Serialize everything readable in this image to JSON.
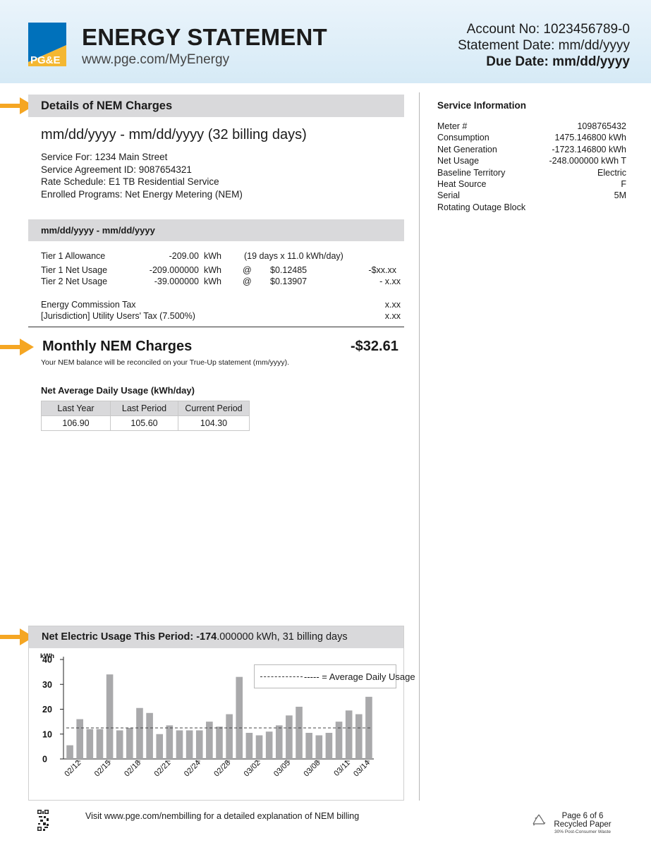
{
  "header": {
    "logo_text": "PG&E",
    "title": "ENERGY STATEMENT",
    "url": "www.pge.com/MyEnergy",
    "account_no": "Account No: 1023456789-0",
    "statement_date": "Statement Date: mm/dd/yyyy",
    "due_date": "Due Date: mm/dd/yyyy"
  },
  "colors": {
    "accent_arrow": "#f5a623",
    "bar_fill": "#a9a9ab",
    "section_bg": "#d9d9db",
    "brand_blue": "#0071bb"
  },
  "details": {
    "title": "Details of NEM Charges",
    "period": "mm/dd/yyyy - mm/dd/yyyy (32 billing days)",
    "service_for": "Service For: 1234 Main Street",
    "service_agreement": "Service Agreement ID: 9087654321",
    "rate_schedule": "Rate Schedule: E1 TB Residential Service",
    "enrolled_programs": "Enrolled Programs: Net Energy Metering (NEM)",
    "subperiod": "mm/dd/yyyy - mm/dd/yyyy",
    "lines": [
      {
        "label": "Tier 1 Allowance",
        "qty": "-209.00",
        "unit": "kWh",
        "at": "",
        "rate": "(19 days x 11.0 kWh/day)",
        "amount": ""
      },
      {
        "label": "Tier 1 Net Usage",
        "qty": "-209.000000",
        "unit": "kWh",
        "at": "@",
        "rate": "$0.12485",
        "amount": "-$xx.xx"
      },
      {
        "label": "Tier 2 Net Usage",
        "qty": "-39.000000",
        "unit": "kWh",
        "at": "@",
        "rate": "$0.13907",
        "amount": "- x.xx"
      }
    ],
    "taxes": [
      {
        "label": "Energy Commission Tax",
        "amount": "x.xx"
      },
      {
        "label": "[Jurisdiction] Utility Users' Tax (7.500%)",
        "amount": "x.xx"
      }
    ],
    "monthly_label": "Monthly NEM Charges",
    "monthly_amount": "-$32.61",
    "monthly_note": "Your NEM balance will be reconciled on your True-Up statement (mm/yyyy)."
  },
  "nadu": {
    "title": "Net Average Daily Usage (kWh/day)",
    "headers": [
      "Last Year",
      "Last Period",
      "Current Period"
    ],
    "values": [
      "106.90",
      "105.60",
      "104.30"
    ]
  },
  "service_info": {
    "title": "Service Information",
    "rows": [
      {
        "label": "Meter #",
        "value": "1098765432"
      },
      {
        "label": "Consumption",
        "value": "1475.146800 kWh"
      },
      {
        "label": "Net Generation",
        "value": "-1723.146800 kWh"
      },
      {
        "label": "Net Usage",
        "value": "-248.000000 kWh T"
      },
      {
        "label": "Baseline Territory",
        "value": "Electric"
      },
      {
        "label": "Heat Source",
        "value": "F"
      },
      {
        "label": "Serial",
        "value": "5M"
      },
      {
        "label": "Rotating Outage Block",
        "value": ""
      }
    ]
  },
  "chart_header": {
    "prefix": "Net Electric Usage This Period: ",
    "bold_value": "-174",
    "suffix": ".000000 kWh, 31 billing days"
  },
  "chart_data": {
    "type": "bar",
    "title": "Net Electric Usage This Period: -174.000000 kWh, 31 billing days",
    "ylabel": "kWh",
    "xlabel": "",
    "ylim": [
      0,
      40
    ],
    "yticks": [
      0,
      10,
      20,
      30,
      40
    ],
    "legend": "----- = Average Daily Usage",
    "legend_position": "top-right",
    "average": 12.5,
    "tick_labels": [
      "02/12",
      "02/15",
      "02/18",
      "02/21",
      "02/24",
      "02/28",
      "03/02",
      "03/05",
      "03/08",
      "03/11",
      "03/14"
    ],
    "values": [
      5.5,
      16,
      12,
      12,
      34,
      11.5,
      12.5,
      20.5,
      18.5,
      10,
      13.5,
      11.5,
      11.5,
      11.5,
      15,
      13,
      18,
      33,
      10.5,
      9.5,
      11,
      13.5,
      17.5,
      21,
      10.5,
      9.5,
      10.5,
      15,
      19.5,
      18,
      25
    ]
  },
  "footer": {
    "text": "Visit www.pge.com/nembilling for a detailed explanation of NEM billing",
    "page": "Page 6 of 6",
    "recycled": "Recycled Paper",
    "recycled_note": "30% Post-Consumer Waste"
  }
}
